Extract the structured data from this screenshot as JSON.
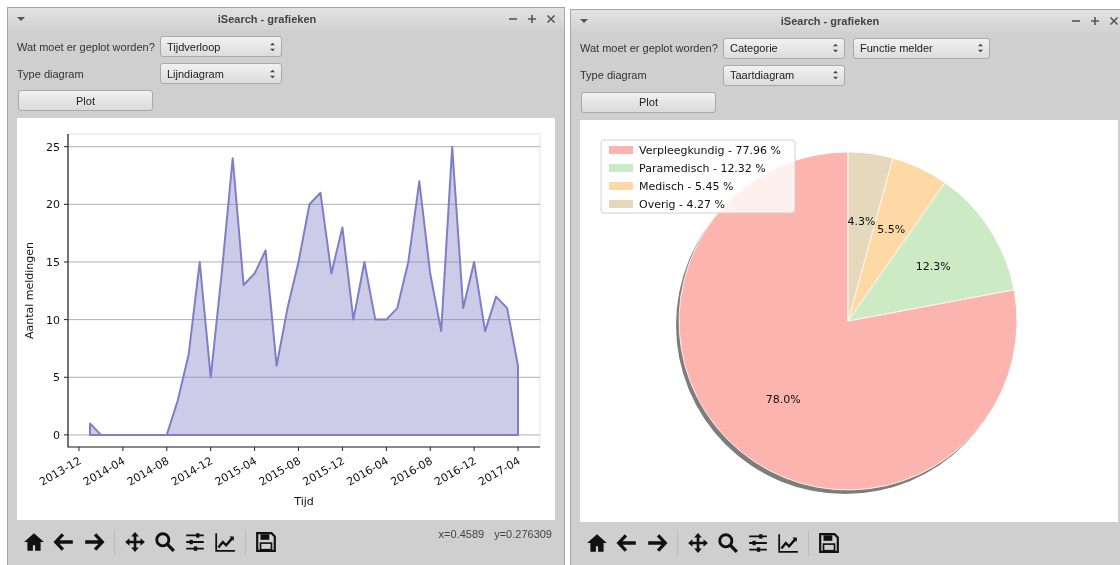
{
  "windows": [
    {
      "title": "iSearch - grafieken",
      "form": [
        {
          "label": "Wat moet er geplot worden?",
          "fields": [
            "Tijdverloop"
          ]
        },
        {
          "label": "Type diagram",
          "fields": [
            "Lijndiagram"
          ]
        }
      ],
      "plot_button": "Plot",
      "figure": {
        "chart_data": {
          "type": "area",
          "xlabel": "Tijd",
          "ylabel": "Aantal meldingen",
          "x": [
            "2014-01",
            "2014-02",
            "2014-03",
            "2014-04",
            "2014-05",
            "2014-06",
            "2014-07",
            "2014-08",
            "2014-09",
            "2014-10",
            "2014-11",
            "2014-12",
            "2015-01",
            "2015-02",
            "2015-03",
            "2015-04",
            "2015-05",
            "2015-06",
            "2015-07",
            "2015-08",
            "2015-09",
            "2015-10",
            "2015-11",
            "2015-12",
            "2016-01",
            "2016-02",
            "2016-03",
            "2016-04",
            "2016-05",
            "2016-06",
            "2016-07",
            "2016-08",
            "2016-09",
            "2016-10",
            "2016-11",
            "2016-12",
            "2017-01",
            "2017-02",
            "2017-03",
            "2017-04"
          ],
          "series": [
            {
              "color": "#7f7fc6",
              "values": [
                1,
                0,
                0,
                0,
                0,
                0,
                0,
                0,
                3,
                7,
                15,
                5,
                14,
                24,
                13,
                14,
                16,
                6,
                11,
                15,
                20,
                21,
                14,
                18,
                10,
                15,
                10,
                10,
                11,
                15,
                22,
                14,
                9,
                25,
                11,
                15,
                9,
                12,
                11,
                6
              ]
            }
          ],
          "xticks": [
            "2013-12",
            "2014-04",
            "2014-08",
            "2014-12",
            "2015-04",
            "2015-08",
            "2015-12",
            "2016-04",
            "2016-08",
            "2016-12",
            "2017-04"
          ],
          "xlim": [
            "2013-11",
            "2017-06"
          ],
          "yticks": [
            0,
            5,
            10,
            15,
            20,
            25
          ],
          "ylim": [
            -1.05,
            26.1
          ],
          "grid": "y"
        }
      },
      "coordinates": [
        "x=0.4589",
        "y=0.276309"
      ]
    },
    {
      "title": "iSearch - grafieken",
      "form": [
        {
          "label": "Wat moet er geplot worden?",
          "fields": [
            "Categorie",
            "Functie melder"
          ]
        },
        {
          "label": "Type diagram",
          "fields": [
            "Taartdiagram"
          ]
        }
      ],
      "plot_button": "Plot",
      "figure": {
        "chart_data": {
          "type": "pie",
          "categories": [
            "Verpleegkundig - 77.96 %",
            "Paramedisch - 12.32 %",
            "Medisch - 5.45 %",
            "Overig - 4.27 %"
          ],
          "values": [
            77.96,
            12.32,
            5.45,
            4.27
          ],
          "colors": [
            "#fbb4ae",
            "#ccebc5",
            "#fed9a6",
            "#e5d8bd"
          ],
          "value_labels": [
            "78.0%",
            "12.3%",
            "5.5%",
            "4.3%"
          ],
          "legend": true
        }
      }
    }
  ]
}
